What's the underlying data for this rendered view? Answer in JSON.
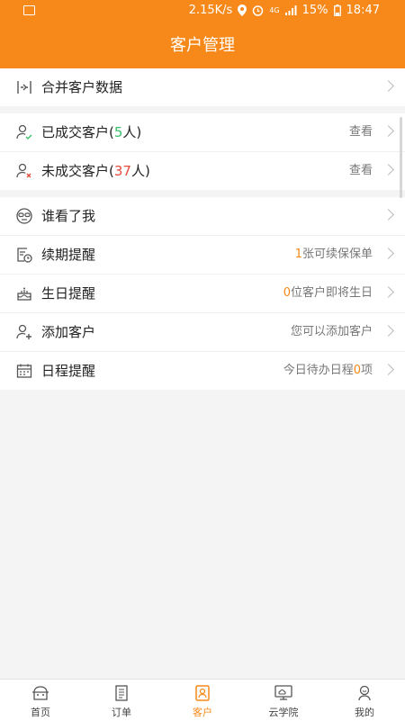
{
  "status": {
    "speed": "2.15K/s",
    "network": "4G",
    "battery": "15%",
    "time": "18:47"
  },
  "header": {
    "title": "客户管理"
  },
  "merge": {
    "label": "合并客户数据"
  },
  "deals": {
    "closed_prefix": "已成交客户(",
    "closed_num": "5",
    "closed_suffix": "人)",
    "closed_right": "查看",
    "open_prefix": "未成交客户(",
    "open_num": "37",
    "open_suffix": "人)",
    "open_right": "查看"
  },
  "features": {
    "viewers_label": "谁看了我",
    "renewal_label": "续期提醒",
    "renewal_num": "1",
    "renewal_text": "张可续保保单",
    "birthday_label": "生日提醒",
    "birthday_num": "0",
    "birthday_text": "位客户即将生日",
    "add_label": "添加客户",
    "add_text": "您可以添加客户",
    "schedule_label": "日程提醒",
    "schedule_prefix": "今日待办日程",
    "schedule_num": "0",
    "schedule_suffix": "项"
  },
  "tabs": [
    {
      "label": "首页",
      "icon": "home-icon"
    },
    {
      "label": "订单",
      "icon": "order-icon"
    },
    {
      "label": "客户",
      "icon": "customer-icon"
    },
    {
      "label": "云学院",
      "icon": "cloud-academy-icon"
    },
    {
      "label": "我的",
      "icon": "profile-icon"
    }
  ],
  "colors": {
    "accent": "#f7891a",
    "green": "#3bbf6b",
    "red": "#e34b3b"
  }
}
